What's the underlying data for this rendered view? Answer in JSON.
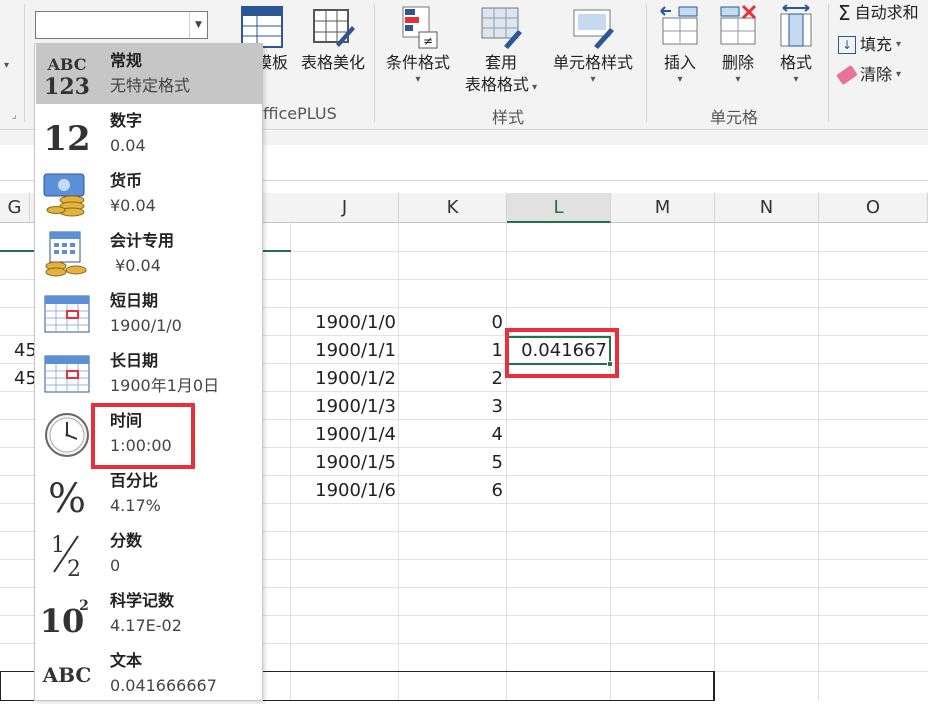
{
  "ribbon": {
    "font_group_fragment": "▾",
    "officeplus_fragment_1": "模板",
    "officeplus_btn": "表格美化",
    "officeplus_group_label": "fficePLUS",
    "cond_format": "条件格式",
    "table_format_line1": "套用",
    "table_format_line2": "表格格式",
    "cell_style": "单元格样式",
    "styles_group_label": "样式",
    "insert": "插入",
    "delete": "删除",
    "format": "格式",
    "cells_group_label": "单元格",
    "autosum": "自动求和",
    "fill": "填充",
    "clear": "清除"
  },
  "number_format_combo": {
    "value": ""
  },
  "columns": [
    {
      "label": "G"
    },
    {
      "label": "J"
    },
    {
      "label": "K"
    },
    {
      "label": "L"
    },
    {
      "label": "M"
    },
    {
      "label": "N"
    },
    {
      "label": "O"
    }
  ],
  "selected_column": "L",
  "cells": {
    "g_fragments": [
      "45",
      "45"
    ],
    "j_values": [
      "1900/1/0",
      "1900/1/1",
      "1900/1/2",
      "1900/1/3",
      "1900/1/4",
      "1900/1/5",
      "1900/1/6"
    ],
    "k_values": [
      "0",
      "1",
      "2",
      "3",
      "4",
      "5",
      "6"
    ],
    "l_active_value": "0.041667"
  },
  "format_menu": [
    {
      "name": "常规",
      "sample": "无特定格式",
      "icon": "general-abc123-icon"
    },
    {
      "name": "数字",
      "sample": "0.04",
      "icon": "number-12-icon"
    },
    {
      "name": "货币",
      "sample": "¥0.04",
      "icon": "currency-icon"
    },
    {
      "name": "会计专用",
      "sample": " ¥0.04",
      "icon": "accounting-icon"
    },
    {
      "name": "短日期",
      "sample": "1900/1/0",
      "icon": "short-date-calendar-icon"
    },
    {
      "name": "长日期",
      "sample": "1900年1月0日",
      "icon": "long-date-calendar-icon"
    },
    {
      "name": "时间",
      "sample": "1:00:00",
      "icon": "clock-icon"
    },
    {
      "name": "百分比",
      "sample": "4.17%",
      "icon": "percent-icon"
    },
    {
      "name": "分数",
      "sample": "0",
      "icon": "fraction-icon"
    },
    {
      "name": "科学记数",
      "sample": "4.17E-02",
      "icon": "scientific-icon"
    },
    {
      "name": "文本",
      "sample": "0.041666667",
      "icon": "text-abc-icon"
    }
  ],
  "colors": {
    "highlight": "#e8303a",
    "excel_green": "#217346",
    "menu_selected": "#c6c6c6"
  }
}
